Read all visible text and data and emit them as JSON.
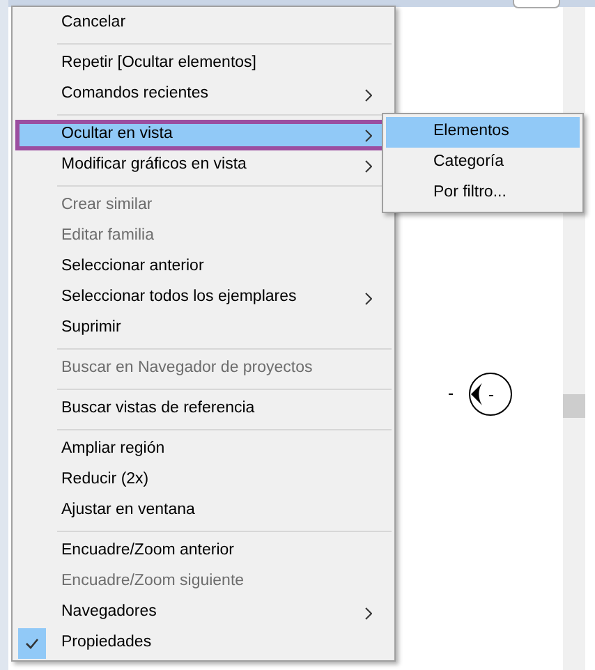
{
  "context_menu": {
    "items": [
      {
        "kind": "item",
        "label": "Cancelar",
        "disabled": false,
        "submenu": false,
        "checked": false,
        "selected": false,
        "outlined": false
      },
      {
        "kind": "separator"
      },
      {
        "kind": "item",
        "label": "Repetir [Ocultar elementos]",
        "disabled": false,
        "submenu": false,
        "checked": false,
        "selected": false,
        "outlined": false
      },
      {
        "kind": "item",
        "label": "Comandos recientes",
        "disabled": false,
        "submenu": true,
        "checked": false,
        "selected": false,
        "outlined": false
      },
      {
        "kind": "separator"
      },
      {
        "kind": "item",
        "label": "Ocultar en vista",
        "disabled": false,
        "submenu": true,
        "checked": false,
        "selected": true,
        "outlined": true
      },
      {
        "kind": "item",
        "label": "Modificar gráficos en vista",
        "disabled": false,
        "submenu": true,
        "checked": false,
        "selected": false,
        "outlined": false
      },
      {
        "kind": "separator"
      },
      {
        "kind": "item",
        "label": "Crear similar",
        "disabled": true,
        "submenu": false,
        "checked": false,
        "selected": false,
        "outlined": false
      },
      {
        "kind": "item",
        "label": "Editar familia",
        "disabled": true,
        "submenu": false,
        "checked": false,
        "selected": false,
        "outlined": false
      },
      {
        "kind": "item",
        "label": "Seleccionar anterior",
        "disabled": false,
        "submenu": false,
        "checked": false,
        "selected": false,
        "outlined": false
      },
      {
        "kind": "item",
        "label": "Seleccionar todos los ejemplares",
        "disabled": false,
        "submenu": true,
        "checked": false,
        "selected": false,
        "outlined": false
      },
      {
        "kind": "item",
        "label": "Suprimir",
        "disabled": false,
        "submenu": false,
        "checked": false,
        "selected": false,
        "outlined": false
      },
      {
        "kind": "separator"
      },
      {
        "kind": "item",
        "label": "Buscar en Navegador de proyectos",
        "disabled": true,
        "submenu": false,
        "checked": false,
        "selected": false,
        "outlined": false
      },
      {
        "kind": "separator"
      },
      {
        "kind": "item",
        "label": "Buscar vistas de referencia",
        "disabled": false,
        "submenu": false,
        "checked": false,
        "selected": false,
        "outlined": false
      },
      {
        "kind": "separator"
      },
      {
        "kind": "item",
        "label": "Ampliar región",
        "disabled": false,
        "submenu": false,
        "checked": false,
        "selected": false,
        "outlined": false
      },
      {
        "kind": "item",
        "label": "Reducir (2x)",
        "disabled": false,
        "submenu": false,
        "checked": false,
        "selected": false,
        "outlined": false
      },
      {
        "kind": "item",
        "label": "Ajustar en ventana",
        "disabled": false,
        "submenu": false,
        "checked": false,
        "selected": false,
        "outlined": false
      },
      {
        "kind": "separator"
      },
      {
        "kind": "item",
        "label": "Encuadre/Zoom anterior",
        "disabled": false,
        "submenu": false,
        "checked": false,
        "selected": false,
        "outlined": false
      },
      {
        "kind": "item",
        "label": "Encuadre/Zoom siguiente",
        "disabled": true,
        "submenu": false,
        "checked": false,
        "selected": false,
        "outlined": false
      },
      {
        "kind": "item",
        "label": "Navegadores",
        "disabled": false,
        "submenu": true,
        "checked": false,
        "selected": false,
        "outlined": false
      },
      {
        "kind": "item",
        "label": "Propiedades",
        "disabled": false,
        "submenu": false,
        "checked": true,
        "selected": false,
        "outlined": false
      }
    ]
  },
  "submenu": {
    "items": [
      {
        "label": "Elementos",
        "selected": true
      },
      {
        "label": "Categoría",
        "selected": false
      },
      {
        "label": "Por filtro...",
        "selected": false
      }
    ]
  }
}
